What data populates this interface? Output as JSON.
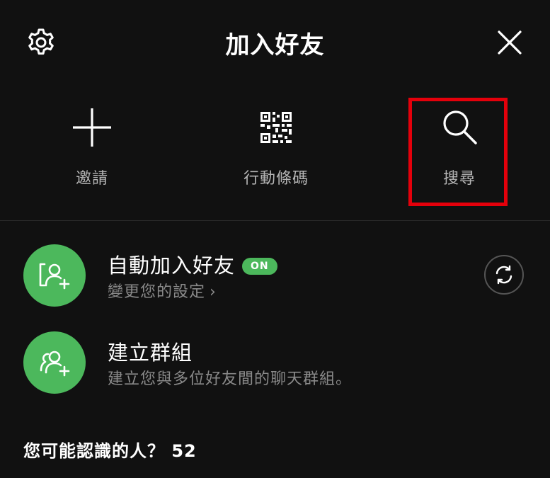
{
  "header": {
    "title": "加入好友",
    "settings_icon": "gear-icon",
    "close_icon": "close-icon"
  },
  "actions": [
    {
      "label": "邀請",
      "icon": "plus-icon"
    },
    {
      "label": "行動條碼",
      "icon": "qr-code-icon"
    },
    {
      "label": "搜尋",
      "icon": "search-icon"
    }
  ],
  "highlight_color": "#e4000b",
  "auto_add": {
    "title": "自動加入好友",
    "badge": "ON",
    "subtitle": "變更您的設定",
    "chevron": "›",
    "icon": "add-friend-icon",
    "refresh_icon": "refresh-icon"
  },
  "create_group": {
    "title": "建立群組",
    "subtitle": "建立您與多位好友間的聊天群組。",
    "icon": "add-group-icon"
  },
  "suggestions": {
    "heading": "您可能認識的人？ 52"
  },
  "colors": {
    "background": "#111111",
    "accent_green": "#4cb85c",
    "text_secondary": "#8a8a8a"
  }
}
